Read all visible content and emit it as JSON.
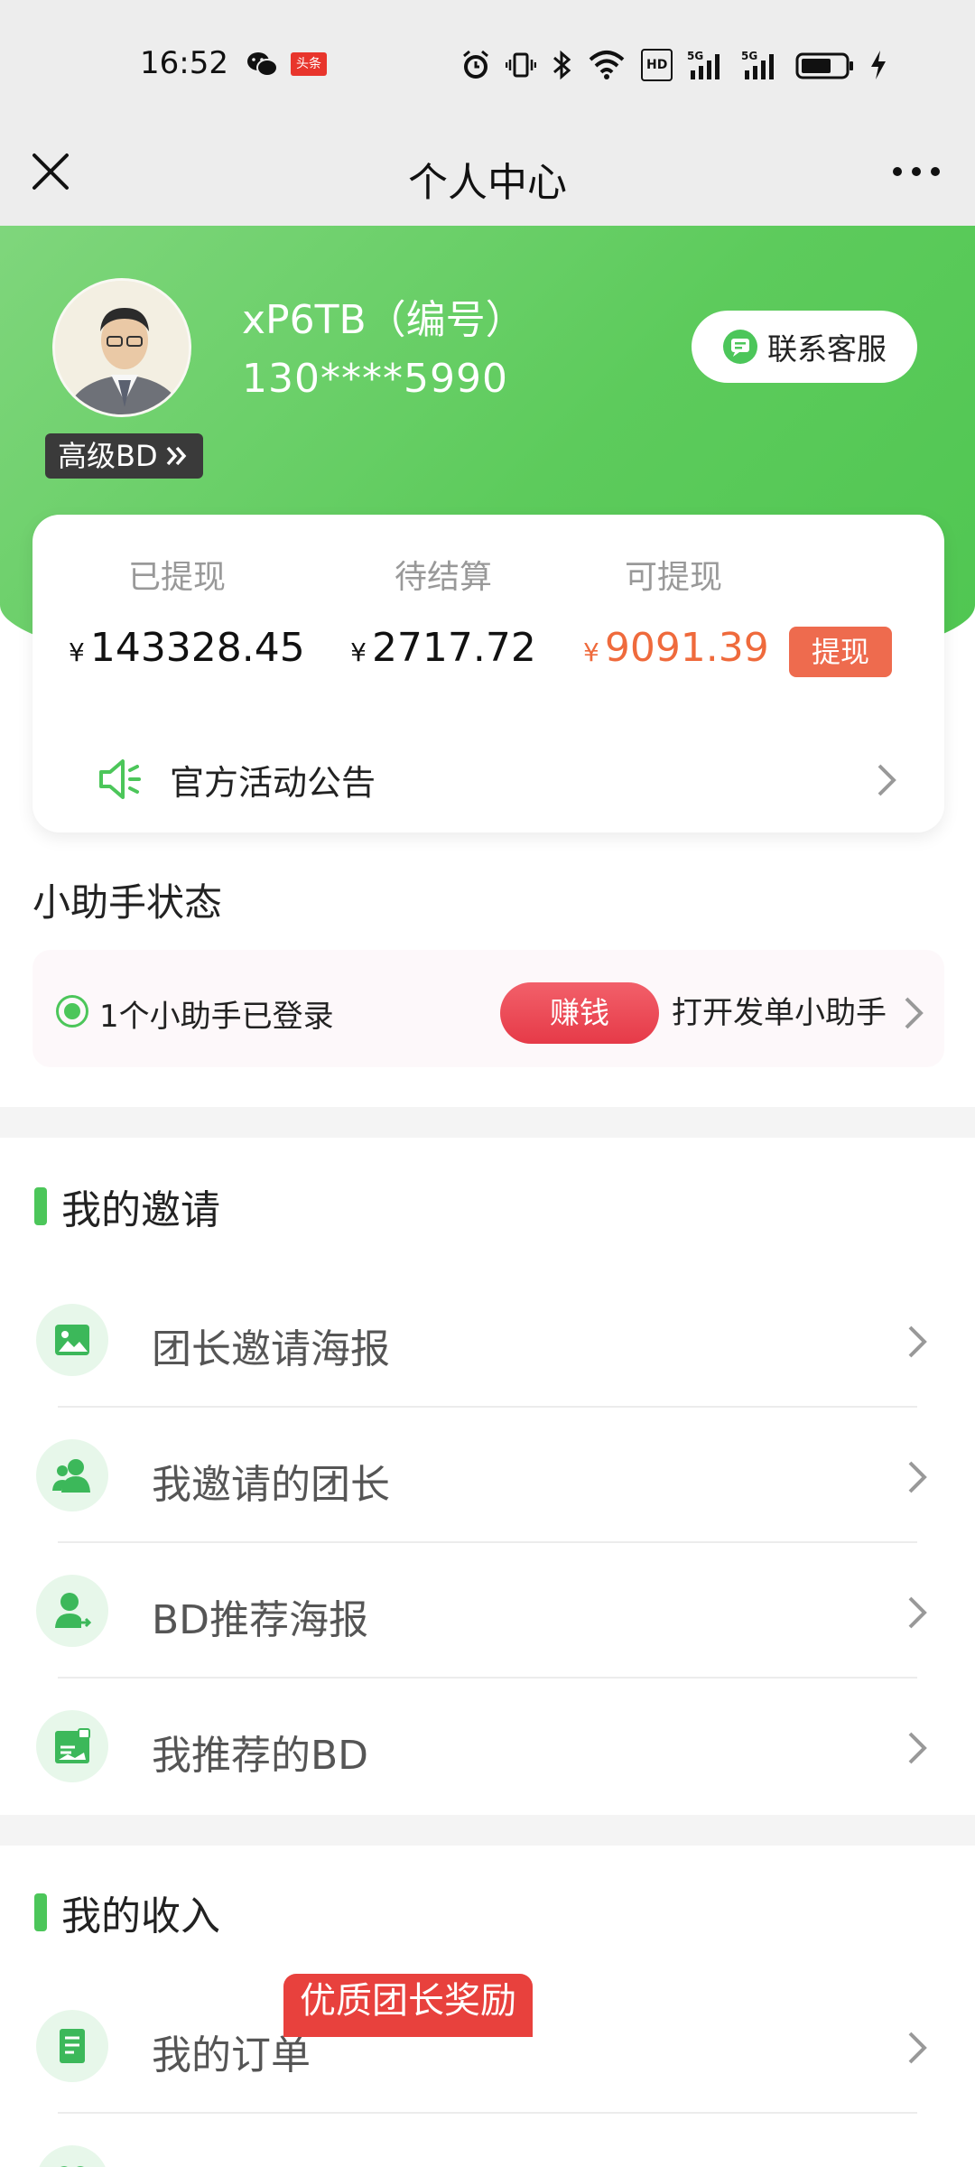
{
  "status_bar": {
    "time": "16:52",
    "toutiao_label": "头条",
    "hd_label": "HD",
    "icons": [
      "wechat-icon",
      "toutiao-icon",
      "alarm-icon",
      "vibrate-icon",
      "bluetooth-icon",
      "wifi-icon",
      "hd-icon",
      "signal-5g-icon",
      "signal-5g-icon",
      "battery-icon",
      "charging-icon"
    ]
  },
  "header": {
    "title": "个人中心"
  },
  "profile": {
    "name": "xP6TB（编号）",
    "phone": "130****5990",
    "level": "高级BD",
    "contact_label": "联系客服"
  },
  "wallet": {
    "withdrawn_label": "已提现",
    "withdrawn_value": "143328.45",
    "pending_label": "待结算",
    "pending_value": "2717.72",
    "available_label": "可提现",
    "available_value": "9091.39",
    "currency": "¥",
    "withdraw_button": "提现",
    "notice_label": "官方活动公告"
  },
  "assistant": {
    "section_title": "小助手状态",
    "status_text": "1个小助手已登录",
    "earn_button": "赚钱",
    "open_text": "打开发单小助手"
  },
  "invite": {
    "section_title": "我的邀请",
    "items": [
      {
        "label": "团长邀请海报",
        "icon": "image-icon"
      },
      {
        "label": "我邀请的团长",
        "icon": "users-icon"
      },
      {
        "label": "BD推荐海报",
        "icon": "user-share-icon"
      },
      {
        "label": "我推荐的BD",
        "icon": "image-badge-icon"
      }
    ]
  },
  "income": {
    "section_title": "我的收入",
    "items": [
      {
        "label": "我的订单",
        "icon": "document-icon"
      },
      {
        "label": "",
        "icon": "heart-icon"
      }
    ],
    "promo_tag": "优质团长奖励"
  },
  "colors": {
    "brand_green": "#4cc65a",
    "orange": "#ef6a3c",
    "red": "#e63a48"
  }
}
